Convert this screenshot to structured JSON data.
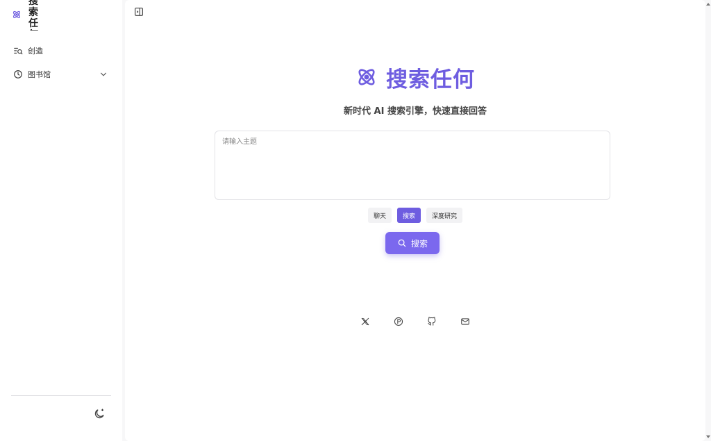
{
  "colors": {
    "accent": "#6e5de0",
    "button": "#7b68ee",
    "background": "#f7f7f8"
  },
  "sidebar": {
    "brand": {
      "name": "搜索任何",
      "icon": "atom-icon"
    },
    "items": [
      {
        "label": "创造",
        "icon": "search-list-icon"
      },
      {
        "label": "图书馆",
        "icon": "clock-icon",
        "expandable": true
      }
    ],
    "theme_toggle_icon": "moon-icon"
  },
  "main": {
    "collapse_icon": "sidebar-toggle-icon",
    "title": "搜索任何",
    "subtitle": "新时代 AI 搜索引擎，快速直接回答",
    "input": {
      "placeholder": "请输入主题",
      "value": ""
    },
    "modes": [
      {
        "label": "聊天",
        "active": false
      },
      {
        "label": "搜索",
        "active": true
      },
      {
        "label": "深度研究",
        "active": false
      }
    ],
    "search_button": {
      "label": "搜索",
      "icon": "search-icon"
    },
    "socials": [
      "x-icon",
      "product-hunt-icon",
      "github-icon",
      "mail-icon"
    ]
  }
}
